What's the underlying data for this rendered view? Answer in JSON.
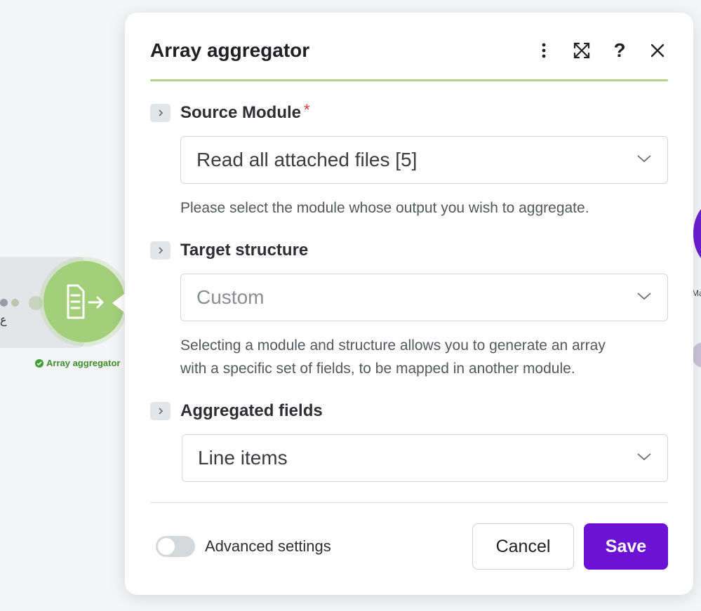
{
  "canvas": {
    "module_label": "Array aggregator",
    "left_glyph": "ع",
    "right_label": "Ma"
  },
  "dialog": {
    "title": "Array aggregator",
    "header_icons": [
      "more-vertical-icon",
      "fullscreen-icon",
      "help-icon",
      "close-icon"
    ],
    "help_glyph": "?"
  },
  "fields": {
    "source_module": {
      "label": "Source Module",
      "required_mark": "*",
      "value": "Read all attached files [5]",
      "hint": "Please select the module whose output you wish to aggregate."
    },
    "target_structure": {
      "label": "Target structure",
      "value": "Custom",
      "hint_line1": "Selecting a module and structure allows you to generate an array",
      "hint_line2": "with a specific set of fields, to be mapped in another module."
    },
    "aggregated_fields": {
      "label": "Aggregated fields",
      "value": "Line items"
    }
  },
  "footer": {
    "advanced_settings_label": "Advanced settings",
    "advanced_settings_on": false,
    "cancel_label": "Cancel",
    "save_label": "Save"
  },
  "colors": {
    "accent_purple": "#6b12d4",
    "module_green": "#a3cf7a",
    "header_rule_green": "#b3d38c",
    "required_red": "#e0373a"
  }
}
